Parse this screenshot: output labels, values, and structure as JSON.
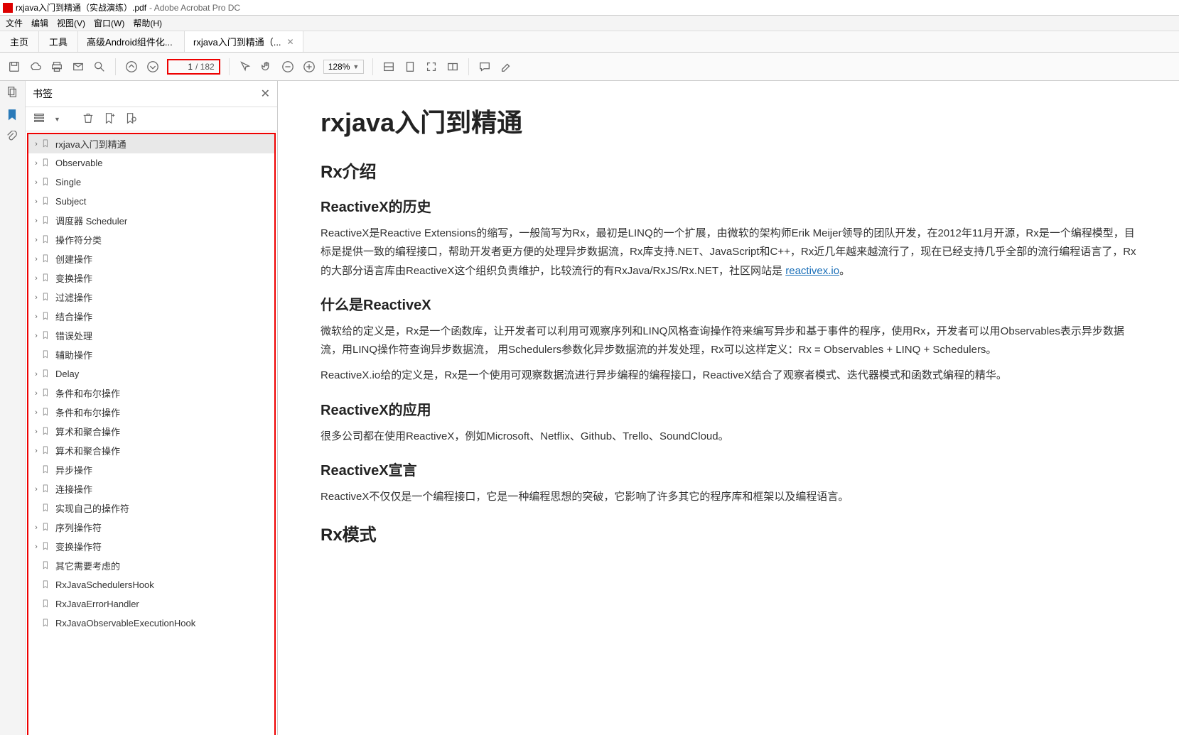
{
  "title_bar": {
    "doc": "rxjava入门到精通（实战演练）.pdf",
    "app": "- Adobe Acrobat Pro DC"
  },
  "menu": {
    "file": "文件",
    "edit": "编辑",
    "view": "视图(V)",
    "window": "窗口(W)",
    "help": "帮助(H)"
  },
  "tabs": {
    "home": "主页",
    "tools": "工具",
    "doc1": "高级Android组件化...",
    "doc2": "rxjava入门到精通（..."
  },
  "toolbar": {
    "page_current": "1",
    "page_total": "/ 182",
    "zoom": "128%"
  },
  "bm_panel": {
    "title": "书签"
  },
  "bookmarks": [
    {
      "label": "rxjava入门到精通",
      "expandable": true,
      "selected": true
    },
    {
      "label": "Observable",
      "expandable": true
    },
    {
      "label": "Single",
      "expandable": true
    },
    {
      "label": "Subject",
      "expandable": true
    },
    {
      "label": "调度器 Scheduler",
      "expandable": true
    },
    {
      "label": "操作符分类",
      "expandable": true
    },
    {
      "label": "创建操作",
      "expandable": true
    },
    {
      "label": "变换操作",
      "expandable": true
    },
    {
      "label": "过滤操作",
      "expandable": true
    },
    {
      "label": "结合操作",
      "expandable": true
    },
    {
      "label": "错误处理",
      "expandable": true
    },
    {
      "label": "辅助操作",
      "expandable": false
    },
    {
      "label": "Delay",
      "expandable": true
    },
    {
      "label": "条件和布尔操作",
      "expandable": true
    },
    {
      "label": "条件和布尔操作",
      "expandable": true
    },
    {
      "label": "算术和聚合操作",
      "expandable": true
    },
    {
      "label": "算术和聚合操作",
      "expandable": true
    },
    {
      "label": "异步操作",
      "expandable": false
    },
    {
      "label": "连接操作",
      "expandable": true
    },
    {
      "label": "实现自己的操作符",
      "expandable": false
    },
    {
      "label": "序列操作符",
      "expandable": true
    },
    {
      "label": "变换操作符",
      "expandable": true
    },
    {
      "label": "其它需要考虑的",
      "expandable": false
    },
    {
      "label": "RxJavaSchedulersHook",
      "expandable": false
    },
    {
      "label": "RxJavaErrorHandler",
      "expandable": false
    },
    {
      "label": "RxJavaObservableExecutionHook",
      "expandable": false
    }
  ],
  "document": {
    "h1": "rxjava入门到精通",
    "h2_1": "Rx介绍",
    "h3_1": "ReactiveX的历史",
    "p1a": "ReactiveX是Reactive Extensions的缩写，一般简写为Rx，最初是LINQ的一个扩展，由微软的架构师Erik Meijer领导的团队开发，在2012年11月开源，Rx是一个编程模型，目标是提供一致的编程接口，帮助开发者更方便的处理异步数据流，Rx库支持.NET、JavaScript和C++，Rx近几年越来越流行了，现在已经支持几乎全部的流行编程语言了，Rx的大部分语言库由ReactiveX这个组织负责维护，比较流行的有RxJava/RxJS/Rx.NET，社区网站是 ",
    "p1_link": "reactivex.io",
    "p1b": "。",
    "h3_2": "什么是ReactiveX",
    "p2": "微软给的定义是，Rx是一个函数库，让开发者可以利用可观察序列和LINQ风格查询操作符来编写异步和基于事件的程序，使用Rx，开发者可以用Observables表示异步数据流，用LINQ操作符查询异步数据流， 用Schedulers参数化异步数据流的并发处理，Rx可以这样定义：Rx = Observables + LINQ + Schedulers。",
    "p3": "ReactiveX.io给的定义是，Rx是一个使用可观察数据流进行异步编程的编程接口，ReactiveX结合了观察者模式、迭代器模式和函数式编程的精华。",
    "h3_3": "ReactiveX的应用",
    "p4": "很多公司都在使用ReactiveX，例如Microsoft、Netflix、Github、Trello、SoundCloud。",
    "h3_4": "ReactiveX宣言",
    "p5": "ReactiveX不仅仅是一个编程接口，它是一种编程思想的突破，它影响了许多其它的程序库和框架以及编程语言。",
    "h2_2": "Rx模式"
  }
}
